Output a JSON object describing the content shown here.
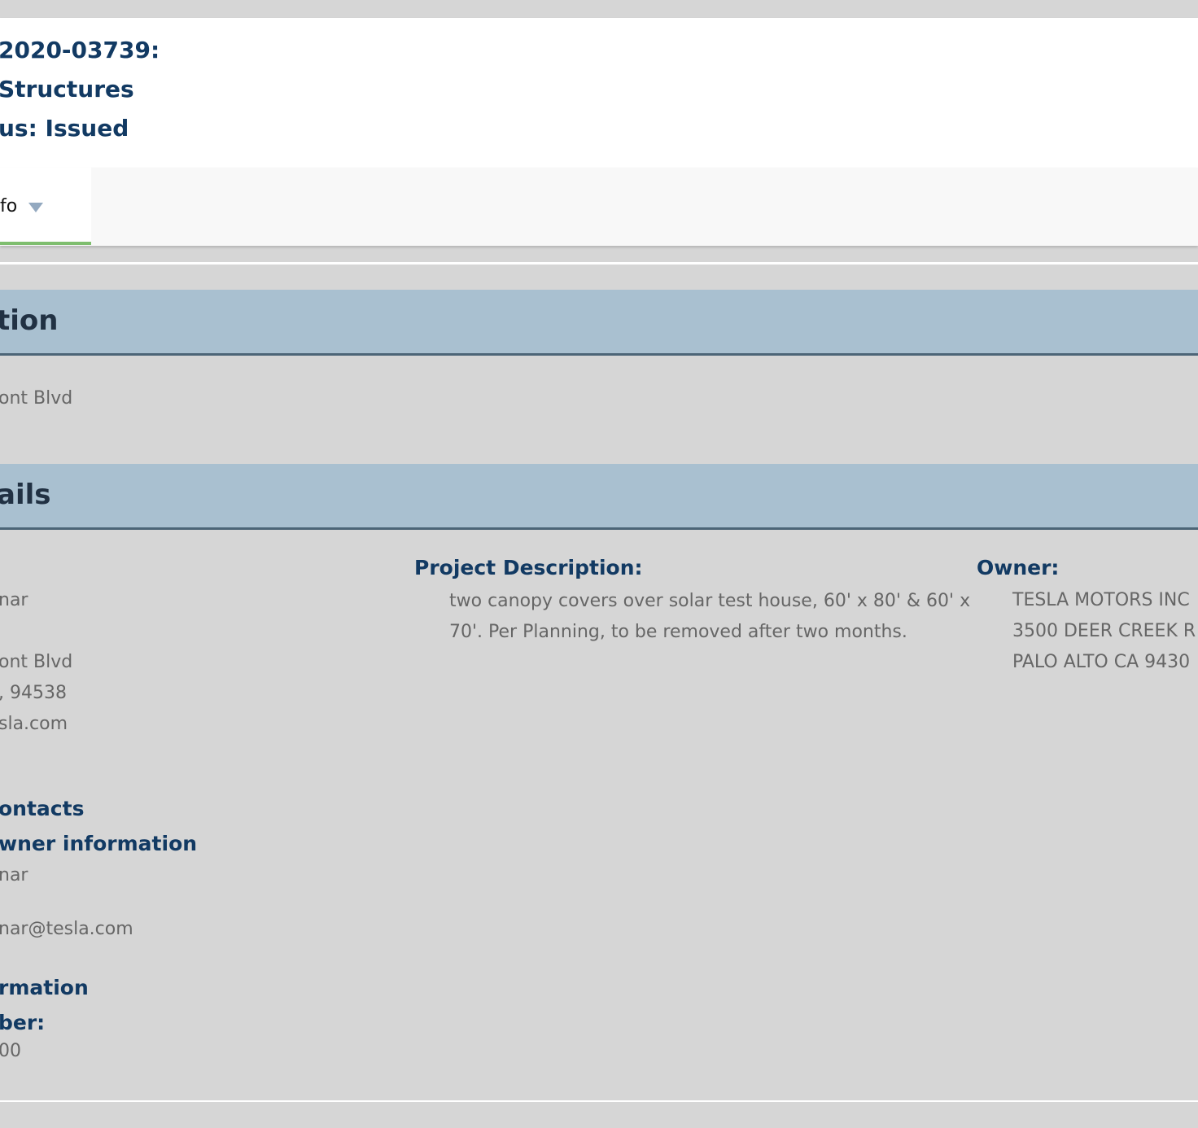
{
  "header": {
    "line1": "2020-03739:",
    "line2": "Structures",
    "line3": "us: Issued"
  },
  "tab": {
    "label": "fo"
  },
  "location": {
    "title": "tion",
    "address": "ont Blvd"
  },
  "details": {
    "title": "ails",
    "applicant": {
      "name": "nar",
      "street": "ont Blvd",
      "city_zip": ", 94538",
      "email": "sla.com"
    },
    "project_description": {
      "label": "Project Description:",
      "text": "two canopy covers over solar test house, 60' x 80' & 60' x 70'. Per Planning, to be removed after two months."
    },
    "owner": {
      "label": "Owner:",
      "name": "TESLA MOTORS INC",
      "street": "3500 DEER CREEK R",
      "city": "PALO ALTO CA 9430"
    },
    "contacts": {
      "heading": "ontacts",
      "subheading": "wner information",
      "name": "nar",
      "email": "nar@tesla.com"
    },
    "information": {
      "heading": "rmation",
      "number_label": "ber:",
      "number_value": "00"
    }
  }
}
